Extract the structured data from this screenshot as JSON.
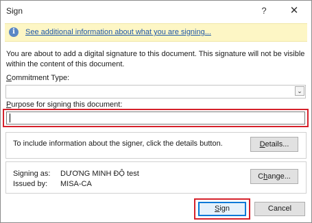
{
  "window": {
    "title": "Sign",
    "help_glyph": "?",
    "close_glyph": "✕"
  },
  "infobar": {
    "icon": "info-icon",
    "icon_glyph": "i",
    "link_text": "See additional information about what you are signing..."
  },
  "description": "You are about to add a digital signature to this document. This signature will not be visible within the content of this document.",
  "commitment": {
    "label_mnemonic": "C",
    "label_rest": "ommitment Type:",
    "value": "",
    "arrow_glyph": "⌄"
  },
  "purpose": {
    "label_mnemonic": "P",
    "label_rest": "urpose for signing this document:",
    "value": ""
  },
  "details_group": {
    "text": "To include information about the signer, click the details button.",
    "button_mnemonic": "D",
    "button_rest": "etails..."
  },
  "signer_group": {
    "signing_as_label": "Signing as:",
    "signing_as_value": "DƯƠNG MINH ĐỘ test",
    "issued_by_label": "Issued by:",
    "issued_by_value": "MISA-CA",
    "change_button_prefix": "C",
    "change_button_mnemonic": "h",
    "change_button_rest": "ange..."
  },
  "buttons": {
    "sign_mnemonic": "S",
    "sign_rest": "ign",
    "cancel": "Cancel"
  },
  "colors": {
    "highlight": "#d5202a",
    "link": "#1d57a7",
    "infobar_bg": "#fdf6c5",
    "focus": "#0078d7"
  }
}
